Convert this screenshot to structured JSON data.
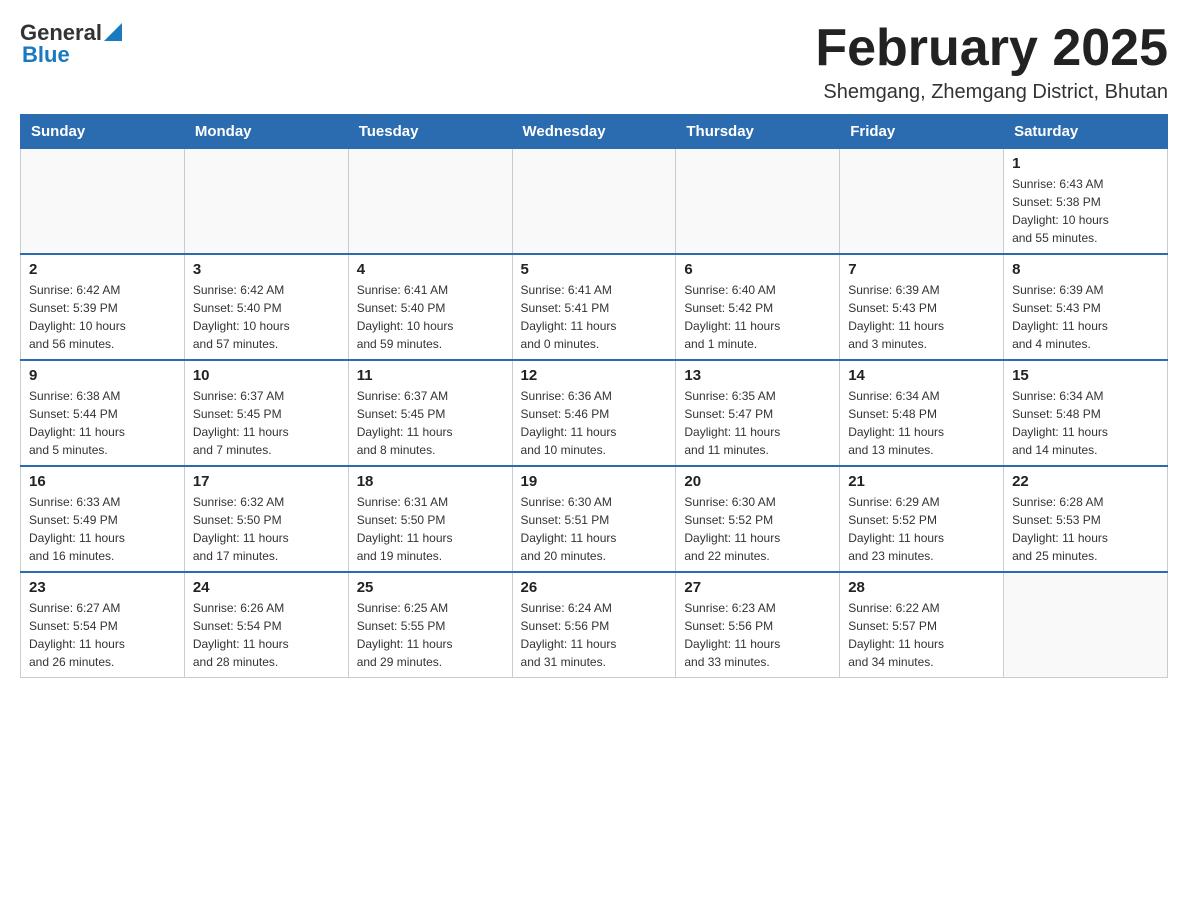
{
  "logo": {
    "text_general": "General",
    "arrow": "▲",
    "text_blue": "Blue"
  },
  "title": "February 2025",
  "subtitle": "Shemgang, Zhemgang District, Bhutan",
  "days_header": [
    "Sunday",
    "Monday",
    "Tuesday",
    "Wednesday",
    "Thursday",
    "Friday",
    "Saturday"
  ],
  "weeks": [
    [
      {
        "day": "",
        "info": ""
      },
      {
        "day": "",
        "info": ""
      },
      {
        "day": "",
        "info": ""
      },
      {
        "day": "",
        "info": ""
      },
      {
        "day": "",
        "info": ""
      },
      {
        "day": "",
        "info": ""
      },
      {
        "day": "1",
        "info": "Sunrise: 6:43 AM\nSunset: 5:38 PM\nDaylight: 10 hours\nand 55 minutes."
      }
    ],
    [
      {
        "day": "2",
        "info": "Sunrise: 6:42 AM\nSunset: 5:39 PM\nDaylight: 10 hours\nand 56 minutes."
      },
      {
        "day": "3",
        "info": "Sunrise: 6:42 AM\nSunset: 5:40 PM\nDaylight: 10 hours\nand 57 minutes."
      },
      {
        "day": "4",
        "info": "Sunrise: 6:41 AM\nSunset: 5:40 PM\nDaylight: 10 hours\nand 59 minutes."
      },
      {
        "day": "5",
        "info": "Sunrise: 6:41 AM\nSunset: 5:41 PM\nDaylight: 11 hours\nand 0 minutes."
      },
      {
        "day": "6",
        "info": "Sunrise: 6:40 AM\nSunset: 5:42 PM\nDaylight: 11 hours\nand 1 minute."
      },
      {
        "day": "7",
        "info": "Sunrise: 6:39 AM\nSunset: 5:43 PM\nDaylight: 11 hours\nand 3 minutes."
      },
      {
        "day": "8",
        "info": "Sunrise: 6:39 AM\nSunset: 5:43 PM\nDaylight: 11 hours\nand 4 minutes."
      }
    ],
    [
      {
        "day": "9",
        "info": "Sunrise: 6:38 AM\nSunset: 5:44 PM\nDaylight: 11 hours\nand 5 minutes."
      },
      {
        "day": "10",
        "info": "Sunrise: 6:37 AM\nSunset: 5:45 PM\nDaylight: 11 hours\nand 7 minutes."
      },
      {
        "day": "11",
        "info": "Sunrise: 6:37 AM\nSunset: 5:45 PM\nDaylight: 11 hours\nand 8 minutes."
      },
      {
        "day": "12",
        "info": "Sunrise: 6:36 AM\nSunset: 5:46 PM\nDaylight: 11 hours\nand 10 minutes."
      },
      {
        "day": "13",
        "info": "Sunrise: 6:35 AM\nSunset: 5:47 PM\nDaylight: 11 hours\nand 11 minutes."
      },
      {
        "day": "14",
        "info": "Sunrise: 6:34 AM\nSunset: 5:48 PM\nDaylight: 11 hours\nand 13 minutes."
      },
      {
        "day": "15",
        "info": "Sunrise: 6:34 AM\nSunset: 5:48 PM\nDaylight: 11 hours\nand 14 minutes."
      }
    ],
    [
      {
        "day": "16",
        "info": "Sunrise: 6:33 AM\nSunset: 5:49 PM\nDaylight: 11 hours\nand 16 minutes."
      },
      {
        "day": "17",
        "info": "Sunrise: 6:32 AM\nSunset: 5:50 PM\nDaylight: 11 hours\nand 17 minutes."
      },
      {
        "day": "18",
        "info": "Sunrise: 6:31 AM\nSunset: 5:50 PM\nDaylight: 11 hours\nand 19 minutes."
      },
      {
        "day": "19",
        "info": "Sunrise: 6:30 AM\nSunset: 5:51 PM\nDaylight: 11 hours\nand 20 minutes."
      },
      {
        "day": "20",
        "info": "Sunrise: 6:30 AM\nSunset: 5:52 PM\nDaylight: 11 hours\nand 22 minutes."
      },
      {
        "day": "21",
        "info": "Sunrise: 6:29 AM\nSunset: 5:52 PM\nDaylight: 11 hours\nand 23 minutes."
      },
      {
        "day": "22",
        "info": "Sunrise: 6:28 AM\nSunset: 5:53 PM\nDaylight: 11 hours\nand 25 minutes."
      }
    ],
    [
      {
        "day": "23",
        "info": "Sunrise: 6:27 AM\nSunset: 5:54 PM\nDaylight: 11 hours\nand 26 minutes."
      },
      {
        "day": "24",
        "info": "Sunrise: 6:26 AM\nSunset: 5:54 PM\nDaylight: 11 hours\nand 28 minutes."
      },
      {
        "day": "25",
        "info": "Sunrise: 6:25 AM\nSunset: 5:55 PM\nDaylight: 11 hours\nand 29 minutes."
      },
      {
        "day": "26",
        "info": "Sunrise: 6:24 AM\nSunset: 5:56 PM\nDaylight: 11 hours\nand 31 minutes."
      },
      {
        "day": "27",
        "info": "Sunrise: 6:23 AM\nSunset: 5:56 PM\nDaylight: 11 hours\nand 33 minutes."
      },
      {
        "day": "28",
        "info": "Sunrise: 6:22 AM\nSunset: 5:57 PM\nDaylight: 11 hours\nand 34 minutes."
      },
      {
        "day": "",
        "info": ""
      }
    ]
  ]
}
